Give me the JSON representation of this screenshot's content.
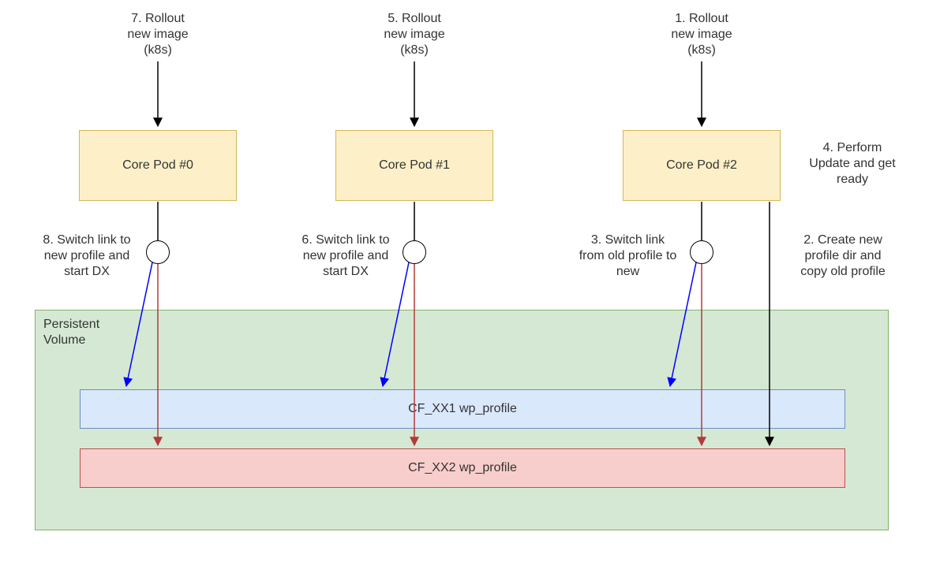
{
  "steps": {
    "s1": "1. Rollout\nnew image\n(k8s)",
    "s2": "2. Create new\nprofile dir and\ncopy old profile",
    "s3": "3. Switch link\nfrom old profile to\nnew",
    "s4": "4. Perform\nUpdate and get\nready",
    "s5": "5. Rollout\nnew image\n(k8s)",
    "s6": "6. Switch link to\nnew profile and\nstart DX",
    "s7": "7. Rollout\nnew image\n(k8s)",
    "s8": "8. Switch link to\nnew profile and\nstart DX"
  },
  "pods": {
    "p0": "Core Pod #0",
    "p1": "Core Pod #1",
    "p2": "Core Pod #2"
  },
  "pv": {
    "title": "Persistent\nVolume",
    "profile1": "CF_XX1 wp_profile",
    "profile2": "CF_XX2 wp_profile"
  },
  "colors": {
    "pod_fill": "#fdf0c8",
    "pod_stroke": "#d6b656",
    "pv_fill": "#d5e8d4",
    "pv_stroke": "#82b366",
    "profile1_fill": "#dae8fc",
    "profile1_stroke": "#6c8ebf",
    "profile2_fill": "#f8cecc",
    "profile2_stroke": "#b85450",
    "arrow_black": "#000000",
    "arrow_blue": "#0000ff",
    "arrow_red": "#b33a3a"
  }
}
